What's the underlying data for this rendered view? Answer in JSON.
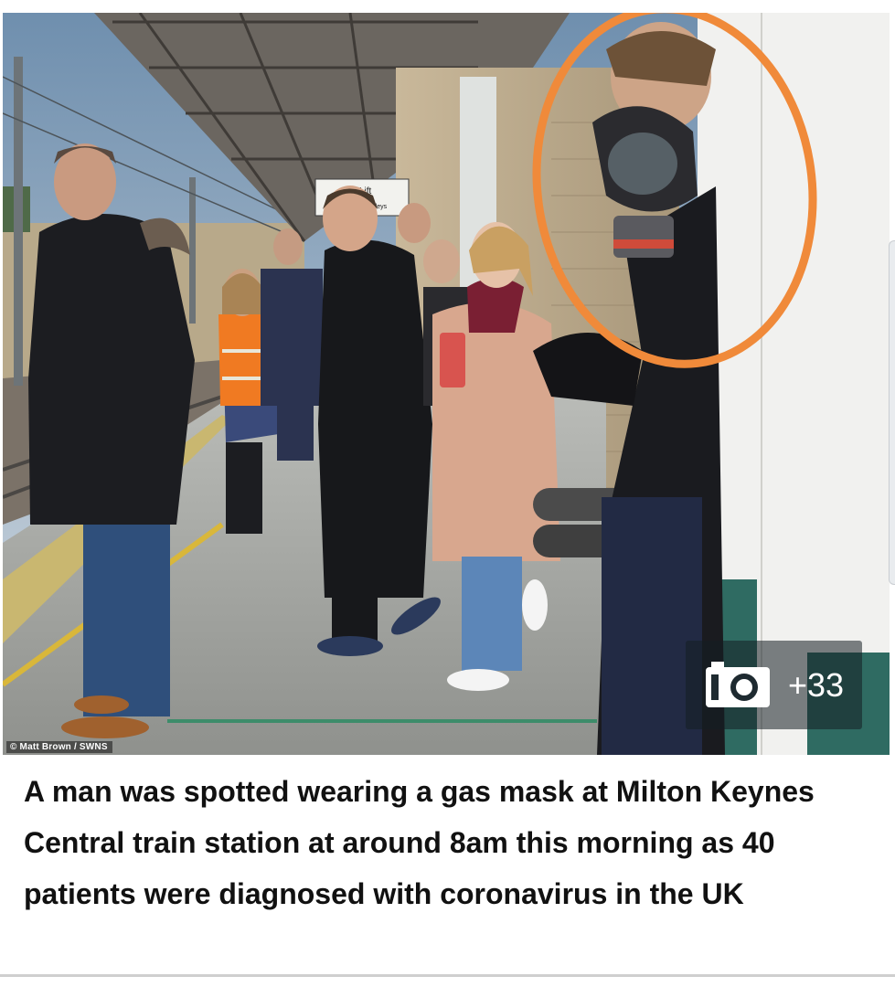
{
  "article": {
    "caption": "A man was spotted wearing a gas mask at Milton Keynes Central train station at around 8am this morning as 40 patients were diagnosed with coronavirus in the UK"
  },
  "photo": {
    "credit": "© Matt Brown / SWNS",
    "station_sign": "Lift",
    "station_sign_sub": "trolleys",
    "highlight_color": "#f08a3a"
  },
  "gallery": {
    "icon": "camera-icon",
    "count_label": "+33"
  }
}
